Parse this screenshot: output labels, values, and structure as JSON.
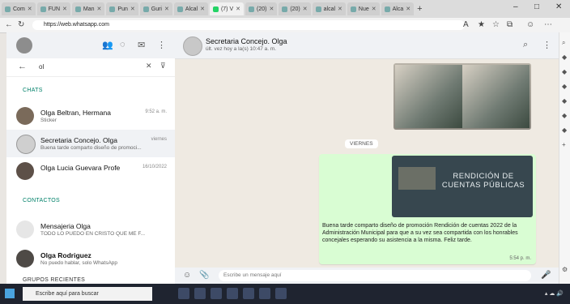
{
  "browser": {
    "tabs": [
      {
        "label": "Com"
      },
      {
        "label": "FUN"
      },
      {
        "label": "Man"
      },
      {
        "label": "Pun"
      },
      {
        "label": "Guri"
      },
      {
        "label": "Alcal"
      },
      {
        "label": "(7) V",
        "active": true
      },
      {
        "label": "(20)"
      },
      {
        "label": "(20)"
      },
      {
        "label": "alcal"
      },
      {
        "label": "Nue"
      },
      {
        "label": "Alca"
      }
    ],
    "new_tab": "+",
    "url": "https://web.whatsapp.com"
  },
  "sidebar": {
    "search_value": "ol",
    "sections": {
      "chats": "CHATS",
      "contacts": "CONTACTOS",
      "groups": "GRUPOS RECIENTES"
    },
    "chats": [
      {
        "name": "Olga Beltran, Hermana",
        "sub": "Sticker",
        "time": "9:52 a. m."
      },
      {
        "name": "Secretaria Concejo. Olga",
        "sub": "Buena tarde comparto diseño de promoci...",
        "time": "viernes",
        "selected": true
      },
      {
        "name": "Olga Lucia Guevara Profe",
        "sub": "",
        "time": "16/10/2022"
      }
    ],
    "contacts": [
      {
        "name": "Mensajeria Olga",
        "sub": "TODO LO PUEDO EN CRISTO QUE ME F..."
      },
      {
        "name": "Olga Rodriguez",
        "sub": "No puedo hablar, solo WhatsApp"
      }
    ]
  },
  "chat": {
    "name": "Secretaria Concejo. Olga",
    "status": "últ. vez hoy a la(s) 10:47 a. m.",
    "day_label": "VIERNES",
    "poster_title": "RENDICIÓN DE CUENTAS PÚBLICAS",
    "caption": "Buena tarde comparto diseño de promoción Rendición de cuentas 2022 de la Administración Municipal para que a su vez sea compartida con los honrables concejales esperando su asistencia a la misma. Feliz tarde.",
    "time": "5:54 p. m.",
    "composer_placeholder": "Escribe un mensaje aquí"
  },
  "taskbar": {
    "search_placeholder": "Escribe aquí para buscar"
  },
  "colors": {
    "accent": "#008069",
    "outgoing_bubble": "#d9fdd3",
    "chat_bg": "#efeae2"
  }
}
